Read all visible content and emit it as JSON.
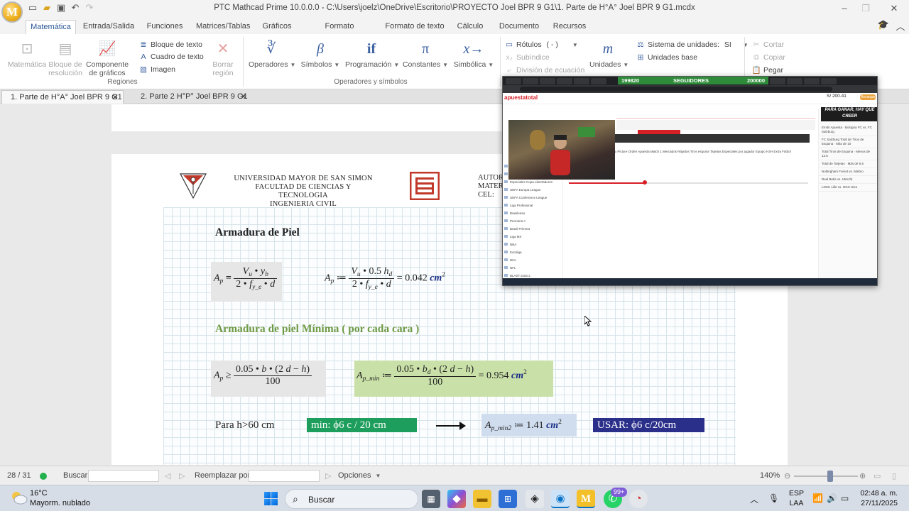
{
  "app": {
    "title": "PTC Mathcad Prime 10.0.0.0 - C:\\Users\\joelz\\OneDrive\\Escritorio\\PROYECTO Joel BPR 9 G1\\1. Parte de H°A° Joel BPR 9 G1.mcdx",
    "logo_letter": "M"
  },
  "ribbon": {
    "tabs": [
      {
        "label": "Matemática",
        "active": true
      },
      {
        "label": "Entrada/Salida",
        "active": false
      },
      {
        "label": "Funciones",
        "active": false
      },
      {
        "label": "Matrices/Tablas",
        "active": false
      },
      {
        "label": "Gráficos",
        "active": false
      },
      {
        "label": "Formato matemático",
        "active": false
      },
      {
        "label": "Formato de texto",
        "active": false
      },
      {
        "label": "Cálculo",
        "active": false
      },
      {
        "label": "Documento",
        "active": false
      },
      {
        "label": "Recursos",
        "active": false
      }
    ],
    "regiones": {
      "matematica": "Matemática",
      "bloque_resolucion": "Bloque de resolución",
      "componente_graficos": "Componente de gráficos",
      "bloque_texto": "Bloque de texto",
      "cuadro_texto": "Cuadro de texto",
      "imagen": "Imagen",
      "borrar_region": "Borrar región",
      "group_label": "Regiones"
    },
    "operadores": {
      "operadores": "Operadores",
      "simbolos": "Símbolos",
      "programacion": "Programación",
      "constantes": "Constantes",
      "simbolica": "Simbólica",
      "group_label": "Operadores y símbolos"
    },
    "rotulos": {
      "rotulos": "Rótulos",
      "rotulos_value": "( - )",
      "subindice": "Subíndice",
      "division": "División de ecuación"
    },
    "unidades": {
      "unidades": "Unidades",
      "sistema": "Sistema de unidades:",
      "sistema_value": "SI",
      "unidades_base": "Unidades base"
    },
    "portapapeles": {
      "cortar": "Cortar",
      "copiar": "Copiar",
      "pegar": "Pegar"
    }
  },
  "doc_tabs": [
    {
      "label": "1. Parte de H°A° Joel BPR 9 G1",
      "active": true
    },
    {
      "label": "2. Parte 2 H°P° Joel BPR 9 G1",
      "active": false
    }
  ],
  "worksheet": {
    "header": {
      "line1": "UNIVERSIDAD MAYOR DE SAN SIMON",
      "line2": "FACULTAD DE CIENCIAS Y TECNOLOGIA",
      "line3": "INGENIERIA CIVIL",
      "autor1": "AUTOR",
      "autor2": "MATER",
      "autor3": "CEL:"
    },
    "section1_title": "Armadura de Piel",
    "section2_title": "Armadura de piel Mínima ( por cada cara )",
    "eq1_result": "0.042",
    "eq2_result": "0.954",
    "eq3_result": "1.41",
    "unit_cm": "cm",
    "para_label": "Para h>60 cm",
    "min_label": "min:  ϕ6 c / 20 cm",
    "usar_label": "USAR:  ϕ6 c/20cm"
  },
  "overlay": {
    "stream_followers_current": "199820",
    "stream_label": "SEGUIDORES",
    "stream_goal": "200000",
    "brand": "apuestatotal",
    "balance": "S/ 200.41",
    "recargar": "Recargar",
    "promo": "PARA GANAR, HAY QUE CREER",
    "sidebar": [
      "Especiales AT Liga 1",
      "Copa Libertadores",
      "Especiales Copa Libertadores",
      "UEFA Europa League",
      "UEFA Conference League",
      "Liga Profesional",
      "Brasileirao",
      "Premiera A",
      "Brasil Primera",
      "Liga MX",
      "NBA",
      "Euroliga",
      "NHL",
      "NFL",
      "BLAST Dota 2"
    ],
    "filters": "Tu Picture  Orden Apuesta  Match 1  Mercados Rápidos  Tiros esquina  Tarjetas  Especiales por jugador  Equipo H2H  Extra  Fútbol",
    "bets": [
      "Emitir Apuesta · Bologna FC vs. FC Salzburg",
      "FC Salzburg Total de Tiros de Esquina · Más de 10",
      "Total Tiros de Esquina · Menos de 12.5",
      "Total de Tarjetas · Más de 5.5",
      "Nottingham Forest vs. Malmo",
      "Real Betis vs. Utrecht",
      "LOSC Lille vs. OGC Nice"
    ]
  },
  "statusbar": {
    "page": "28 / 31",
    "buscar": "Buscar:",
    "reemplazar": "Reemplazar por:",
    "opciones": "Opciones",
    "zoom": "140%"
  },
  "taskbar": {
    "temp": "16°C",
    "weather": "Mayorm. nublado",
    "search": "Buscar",
    "badge": "99+",
    "lang1": "ESP",
    "lang2": "LAA",
    "time": "02:48 a. m.",
    "date": "27/11/2025"
  },
  "colors": {
    "accent": "#2b5797",
    "green_label": "#6f9a45",
    "pill_green": "#1e9e5c",
    "pill_navy": "#2a2f8a",
    "eq_green": "#c9e0a8",
    "eq_gray": "#e6e6e6",
    "eq_blue": "#d0ddee"
  }
}
